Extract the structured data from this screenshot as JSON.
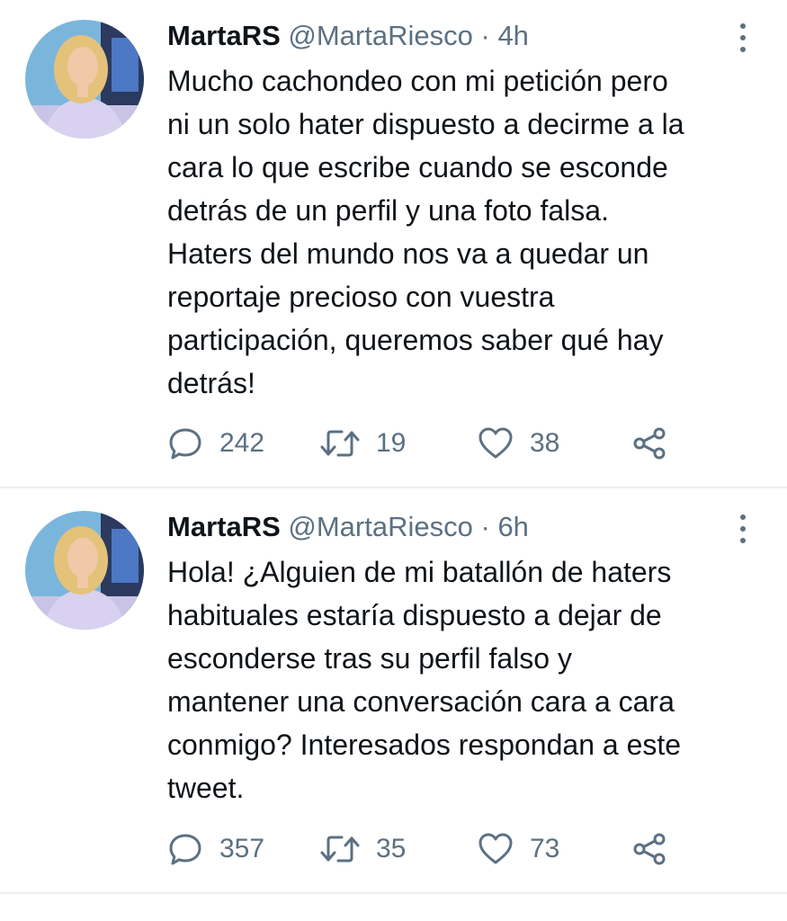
{
  "tweets": [
    {
      "name": "MartaRS",
      "handle": "@MartaRiesco",
      "separator": "·",
      "time": "4h",
      "text": "Mucho cachondeo con mi petición pero\nni un solo hater dispuesto a decirme a la\ncara lo que escribe cuando se esconde\ndetrás de un perfil y una foto falsa.\nHaters del mundo nos va a quedar un\nreportaje precioso con vuestra\nparticipación, queremos saber qué hay\ndetrás!",
      "replies": "242",
      "retweets": "19",
      "likes": "38"
    },
    {
      "name": "MartaRS",
      "handle": "@MartaRiesco",
      "separator": "·",
      "time": "6h",
      "text": "Hola! ¿Alguien de mi batallón de haters\nhabituales estaría dispuesto a dejar de\nesconderse tras su perfil falso y\nmantener una conversación cara a cara\nconmigo? Interesados respondan a este\ntweet.",
      "replies": "357",
      "retweets": "35",
      "likes": "73"
    }
  ],
  "icons": {
    "reply": "reply-icon",
    "retweet": "retweet-icon",
    "like": "heart-icon",
    "share": "share-icon",
    "more": "more-vertical-icon"
  },
  "colors": {
    "text": "#0f1419",
    "secondary": "#5b7083",
    "divider": "#ebeef0"
  }
}
